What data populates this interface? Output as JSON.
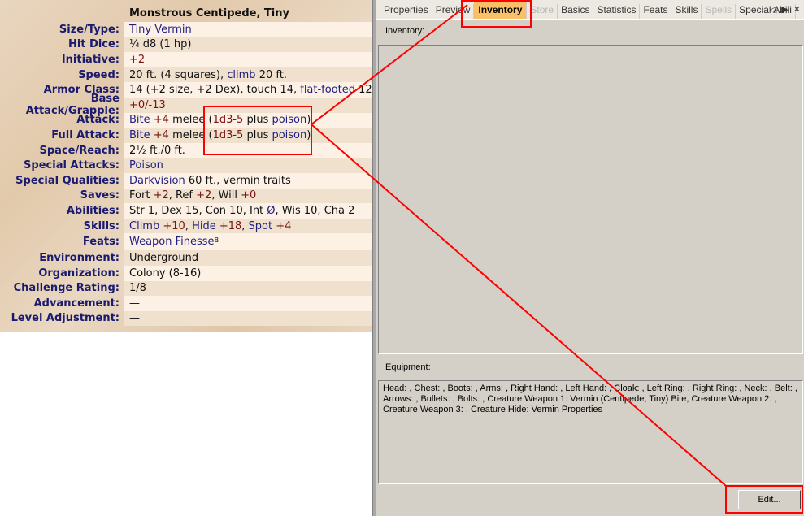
{
  "statblock": {
    "title": "Monstrous Centipede, Tiny",
    "rows": [
      {
        "label": "Size/Type:",
        "value": [
          {
            "t": "Tiny Vermin",
            "s": "link"
          }
        ]
      },
      {
        "label": "Hit Dice:",
        "value": [
          {
            "t": "¼ d8 (1 hp)"
          }
        ]
      },
      {
        "label": "Initiative:",
        "value": [
          {
            "t": "+2",
            "s": "num"
          }
        ]
      },
      {
        "label": "Speed:",
        "value": [
          {
            "t": "20 ft. (4 squares), "
          },
          {
            "t": "climb",
            "s": "link"
          },
          {
            "t": " 20 ft."
          }
        ]
      },
      {
        "label": "Armor Class:",
        "value": [
          {
            "t": "14 (+2 size, +2 Dex), touch 14, "
          },
          {
            "t": "flat-footed",
            "s": "link"
          },
          {
            "t": " 12"
          }
        ]
      },
      {
        "label": "Base Attack/Grapple:",
        "value": [
          {
            "t": "+0/-13",
            "s": "num"
          }
        ]
      },
      {
        "label": "Attack:",
        "value": [
          {
            "t": "Bite",
            "s": "link"
          },
          {
            "t": " "
          },
          {
            "t": "+4",
            "s": "num"
          },
          {
            "t": " melee ("
          },
          {
            "t": "1d3-5",
            "s": "num"
          },
          {
            "t": " plus "
          },
          {
            "t": "poison",
            "s": "link"
          },
          {
            "t": ")"
          }
        ]
      },
      {
        "label": "Full Attack:",
        "value": [
          {
            "t": "Bite",
            "s": "link"
          },
          {
            "t": " "
          },
          {
            "t": "+4",
            "s": "num"
          },
          {
            "t": " melee ("
          },
          {
            "t": "1d3-5",
            "s": "num"
          },
          {
            "t": " plus "
          },
          {
            "t": "poison",
            "s": "link"
          },
          {
            "t": ")"
          }
        ]
      },
      {
        "label": "Space/Reach:",
        "value": [
          {
            "t": "2½ ft./0 ft."
          }
        ]
      },
      {
        "label": "Special Attacks:",
        "value": [
          {
            "t": "Poison",
            "s": "link"
          }
        ]
      },
      {
        "label": "Special Qualities:",
        "value": [
          {
            "t": "Darkvision",
            "s": "link"
          },
          {
            "t": " 60 ft., vermin traits"
          }
        ]
      },
      {
        "label": "Saves:",
        "value": [
          {
            "t": "Fort "
          },
          {
            "t": "+2",
            "s": "num"
          },
          {
            "t": ", Ref "
          },
          {
            "t": "+2",
            "s": "num"
          },
          {
            "t": ", Will "
          },
          {
            "t": "+0",
            "s": "num"
          }
        ]
      },
      {
        "label": "Abilities:",
        "value": [
          {
            "t": "Str 1, Dex 15, Con 10, Int "
          },
          {
            "t": "Ø",
            "s": "link"
          },
          {
            "t": ", Wis 10, Cha 2"
          }
        ]
      },
      {
        "label": "Skills:",
        "value": [
          {
            "t": "Climb",
            "s": "link"
          },
          {
            "t": " "
          },
          {
            "t": "+10",
            "s": "num"
          },
          {
            "t": ", "
          },
          {
            "t": "Hide",
            "s": "link"
          },
          {
            "t": " "
          },
          {
            "t": "+18",
            "s": "num"
          },
          {
            "t": ", "
          },
          {
            "t": "Spot",
            "s": "link"
          },
          {
            "t": " "
          },
          {
            "t": "+4",
            "s": "num"
          }
        ]
      },
      {
        "label": "Feats:",
        "value": [
          {
            "t": "Weapon Finesse",
            "s": "link"
          },
          {
            "t": "B",
            "s": "sup"
          }
        ]
      },
      {
        "label": "Environment:",
        "value": [
          {
            "t": "Underground"
          }
        ]
      },
      {
        "label": "Organization:",
        "value": [
          {
            "t": "Colony (8-16)"
          }
        ]
      },
      {
        "label": "Challenge Rating:",
        "value": [
          {
            "t": "1/8"
          }
        ]
      },
      {
        "label": "Advancement:",
        "value": [
          {
            "t": "—"
          }
        ]
      },
      {
        "label": "Level Adjustment:",
        "value": [
          {
            "t": "—"
          }
        ]
      }
    ]
  },
  "tabs": [
    {
      "label": "Properties",
      "state": "normal"
    },
    {
      "label": "Preview",
      "state": "normal"
    },
    {
      "label": "Inventory",
      "state": "active"
    },
    {
      "label": "Store",
      "state": "disabled"
    },
    {
      "label": "Basics",
      "state": "normal"
    },
    {
      "label": "Statistics",
      "state": "normal"
    },
    {
      "label": "Feats",
      "state": "normal"
    },
    {
      "label": "Skills",
      "state": "normal"
    },
    {
      "label": "Spells",
      "state": "disabled"
    },
    {
      "label": "Special Abili",
      "state": "normal"
    }
  ],
  "tab_controls": {
    "prev": "◁",
    "next": "▶",
    "close": "✕"
  },
  "inventory": {
    "label": "Inventory:",
    "value": ""
  },
  "equipment": {
    "label": "Equipment:",
    "value": "Head: , Chest: , Boots: , Arms: , Right Hand: , Left Hand: , Cloak: , Left Ring: , Right Ring: , Neck: , Belt: , Arrows: , Bullets: , Bolts: , Creature Weapon 1: Vermin (Centipede, Tiny) Bite, Creature Weapon 2: , Creature Weapon 3: , Creature Hide: Vermin Properties"
  },
  "edit_button": "Edit...",
  "colors": {
    "link": "#1e1e80",
    "number": "#7a1414",
    "active_tab": "#f9c068",
    "annotation": "#ff0000"
  }
}
